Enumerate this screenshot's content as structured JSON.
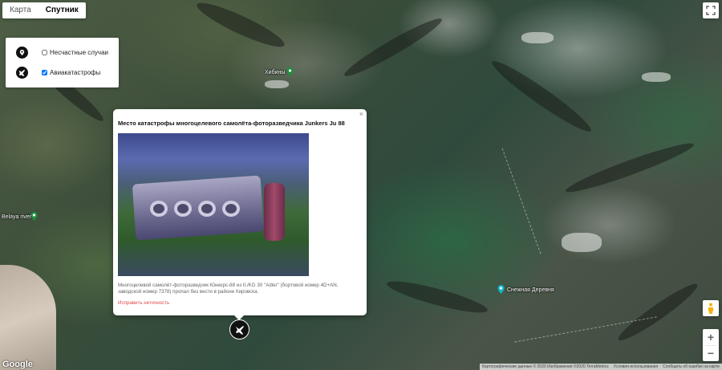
{
  "map_type": {
    "options": [
      "Карта",
      "Спутник"
    ],
    "selected": "Спутник"
  },
  "layers": [
    {
      "label": "Несчастные случаи",
      "icon": "pin-icon",
      "checked": false
    },
    {
      "label": "Авиакатастрофы",
      "icon": "plane-crash-icon",
      "checked": true
    }
  ],
  "places": [
    {
      "name": "Хибины",
      "icon": "park-pin"
    },
    {
      "name": "Belaya river",
      "icon": "park-pin"
    },
    {
      "name": "Снежная Деревня",
      "icon": "attraction-pin"
    }
  ],
  "info": {
    "title": "Место катастрофы многоцелевого самолёта-фоторазведчика Junkers Ju 88",
    "close_glyph": "×",
    "description": "Многоцелевой самолёт-фоторазведчик Юнкерс-88 из II./KG 30 \"Adler\" (бортовой номер 4D+AN, заводской номер 7378) пропал без вести в районе Кировска.",
    "report_link": "Исправить неточность"
  },
  "controls": {
    "zoom_in": "+",
    "zoom_out": "−",
    "logo": "Google"
  },
  "attribution": [
    "Картографические данные © 2020 Изображения ©2020 TerraMetrics",
    "Условия использования",
    "Сообщить об ошибке на карте"
  ],
  "colors": {
    "marker": "#111111",
    "link": "#e04b4b"
  }
}
